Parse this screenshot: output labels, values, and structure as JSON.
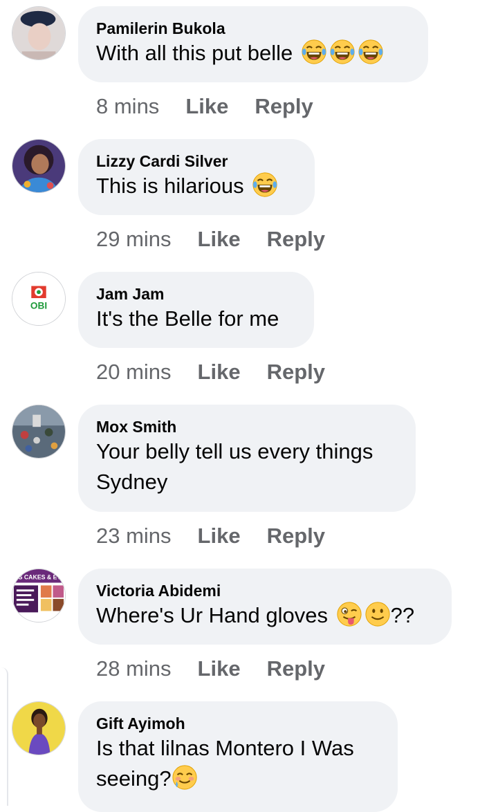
{
  "comments": [
    {
      "author": "Pamilerin Bukola",
      "lines": [
        "With all this put belle"
      ],
      "emojis": [
        "laughing-tears",
        "laughing-tears",
        "laughing-tears"
      ],
      "time": "8 mins"
    },
    {
      "author": "Lizzy Cardi Silver",
      "lines": [
        "This is hilarious"
      ],
      "emojis": [
        "laughing-tears"
      ],
      "time": "29 mins"
    },
    {
      "author": "Jam Jam",
      "lines": [
        "It's the Belle for me"
      ],
      "avatar_text": "OBI",
      "time": "20 mins"
    },
    {
      "author": "Mox Smith",
      "lines": [
        "Your belly tell us every things",
        "Sydney"
      ],
      "time": "23 mins"
    },
    {
      "author": "Victoria Abidemi",
      "lines": [
        "Where's Ur Hand gloves"
      ],
      "emojis": [
        "winking-tongue",
        "slight-smile"
      ],
      "suffix": "??",
      "avatar_text": "OLA’S CAKES & EVENT",
      "time": "28 mins"
    },
    {
      "author": "Gift Ayimoh",
      "lines": [
        "Is that lilnas Montero I Was",
        "seeing?"
      ],
      "emojis": [
        "smiling-with-tear"
      ],
      "time": ""
    }
  ],
  "actions": {
    "like": "Like",
    "reply": "Reply"
  },
  "colors": {
    "bubble": "#f0f2f5",
    "meta_text": "#65676b",
    "text": "#050505",
    "emoji_yellow": "#ffcc4d"
  }
}
